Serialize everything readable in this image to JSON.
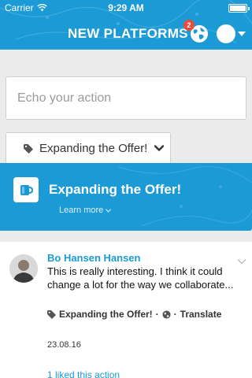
{
  "status_bar": {
    "carrier": "Carrier",
    "time": "9:29 AM"
  },
  "header": {
    "title": "NEW PLATFORMS",
    "notification_count": "2",
    "brand_color": "#1c9ad6"
  },
  "composer": {
    "placeholder": "Echo your action"
  },
  "tag_filter": {
    "label": "Expanding the Offer!",
    "icon": "tag-icon"
  },
  "banner": {
    "title": "Expanding the Offer!",
    "learn_more": "Learn more",
    "icon": "mug-icon"
  },
  "feed": {
    "items": [
      {
        "author": "Bo Hansen Hansen",
        "text": "This is really interesting. I think it could change a lot for the way we collaborate...",
        "tag": "Expanding the Offer!",
        "separator1": "·",
        "separator2": "·",
        "translate": "Translate",
        "date": "23.08.16",
        "likes": "1 liked this action"
      }
    ]
  }
}
